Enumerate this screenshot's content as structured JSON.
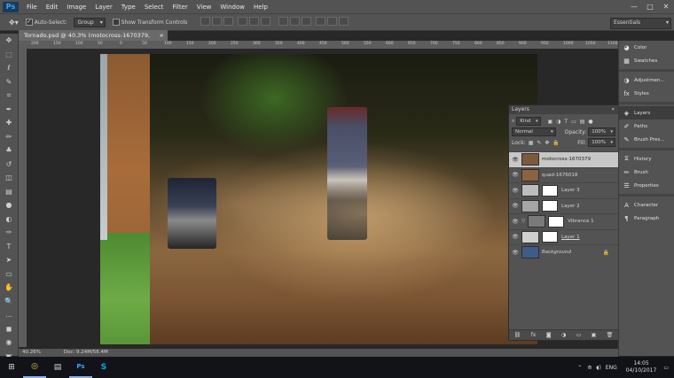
{
  "app": {
    "logo": "Ps"
  },
  "menu": [
    "File",
    "Edit",
    "Image",
    "Layer",
    "Type",
    "Select",
    "Filter",
    "View",
    "Window",
    "Help"
  ],
  "window_controls": {
    "minimize": "—",
    "maximize": "□",
    "close": "✕"
  },
  "options": {
    "tool_icon": "move-tool-icon",
    "auto_select_label": "Auto-Select:",
    "auto_select_checked": true,
    "auto_select_target": "Group",
    "transform_label": "Show Transform Controls",
    "transform_checked": false,
    "workspace": "Essentials"
  },
  "document": {
    "tab_title": "Tornado.psd @ 40.3% (motocross-1670379, RGB/8#) *",
    "close": "×",
    "zoom": "40.26%",
    "doc_size": "Doc: 9.24M/56.4M"
  },
  "ruler_ticks": [
    "200",
    "150",
    "100",
    "50",
    "0",
    "50",
    "100",
    "150",
    "200",
    "250",
    "300",
    "350",
    "400",
    "450",
    "500",
    "550",
    "600",
    "650",
    "700",
    "750",
    "800",
    "850",
    "900",
    "950",
    "1000",
    "1050",
    "1100"
  ],
  "tools": [
    "move",
    "marquee",
    "lasso",
    "quick-select",
    "crop",
    "eyedropper",
    "healing",
    "brush",
    "clone-stamp",
    "history-brush",
    "eraser",
    "gradient",
    "blur",
    "dodge",
    "pen",
    "type",
    "path-select",
    "rectangle",
    "hand",
    "zoom",
    "more",
    "colors",
    "mask",
    "screen-mode"
  ],
  "tool_glyphs": [
    "✥",
    "⬚",
    "ℓ",
    "✎",
    "⌗",
    "✒",
    "✚",
    "✏",
    "♣",
    "↺",
    "◫",
    "▤",
    "●",
    "◐",
    "✑",
    "T",
    "➤",
    "▭",
    "✋",
    "🔍",
    "…",
    "◼",
    "◉",
    "▣"
  ],
  "dock": [
    {
      "label": "Color",
      "icon": "color-icon",
      "glyph": "◕"
    },
    {
      "label": "Swatches",
      "icon": "swatches-icon",
      "glyph": "▦"
    },
    {
      "label": "Adjustmen...",
      "icon": "adjustments-icon",
      "glyph": "◑"
    },
    {
      "label": "Styles",
      "icon": "styles-icon",
      "glyph": "fx"
    },
    {
      "label": "Layers",
      "icon": "layers-icon",
      "glyph": "◈"
    },
    {
      "label": "Paths",
      "icon": "paths-icon",
      "glyph": "✐"
    },
    {
      "label": "Brush Pres...",
      "icon": "brush-presets-icon",
      "glyph": "✎"
    },
    {
      "label": "History",
      "icon": "history-icon",
      "glyph": "⧖"
    },
    {
      "label": "Brush",
      "icon": "brush-icon",
      "glyph": "✏"
    },
    {
      "label": "Properties",
      "icon": "properties-icon",
      "glyph": "☰"
    },
    {
      "label": "Character",
      "icon": "character-icon",
      "glyph": "A"
    },
    {
      "label": "Paragraph",
      "icon": "paragraph-icon",
      "glyph": "¶"
    }
  ],
  "layers_panel": {
    "title": "Layers",
    "close": "«",
    "kind": "Kind",
    "blend_mode": "Normal",
    "opacity_label": "Opacity:",
    "opacity": "100%",
    "lock_label": "Lock:",
    "fill_label": "Fill:",
    "fill": "100%",
    "layers": [
      {
        "name": "motocross-1670379",
        "selected": true,
        "thumb": "#7a5a3a",
        "mask": false,
        "adj": "",
        "lock": ""
      },
      {
        "name": "quad-1676018",
        "selected": false,
        "thumb": "#8a6440",
        "mask": false,
        "adj": "",
        "lock": ""
      },
      {
        "name": "Layer 3",
        "selected": false,
        "thumb": "#bdbdbd",
        "mask": true,
        "adj": "",
        "lock": ""
      },
      {
        "name": "Layer 2",
        "selected": false,
        "thumb": "#a5a5a5",
        "mask": true,
        "adj": "",
        "lock": ""
      },
      {
        "name": "Vibrance 1",
        "selected": false,
        "thumb": "#7a7a7a",
        "mask": true,
        "adj": "▽",
        "lock": ""
      },
      {
        "name": "Layer 1",
        "selected": false,
        "thumb": "#cfcfcf",
        "mask": true,
        "adj": "",
        "lock": "",
        "underline": true
      },
      {
        "name": "Background",
        "selected": false,
        "thumb": "#3d5c8a",
        "mask": false,
        "adj": "",
        "lock": "🔒",
        "italic": true
      }
    ],
    "footer": [
      "⛓",
      "fx",
      "◙",
      "◑",
      "▭",
      "▣",
      "🗑"
    ]
  },
  "taskbar": {
    "apps": [
      {
        "name": "start",
        "glyph": "⊞",
        "on": false
      },
      {
        "name": "chrome",
        "glyph": "◎",
        "on": true
      },
      {
        "name": "files",
        "glyph": "▤",
        "on": false
      },
      {
        "name": "photoshop",
        "glyph": "Ps",
        "on": true
      },
      {
        "name": "skype",
        "glyph": "S",
        "on": false
      }
    ],
    "tray": {
      "up": "⌃",
      "lang": "ENG",
      "time": "14:05",
      "date": "04/10/2017"
    }
  },
  "colors": {
    "accent": "#31a8ff",
    "panel": "#535353",
    "dark": "#282828"
  }
}
